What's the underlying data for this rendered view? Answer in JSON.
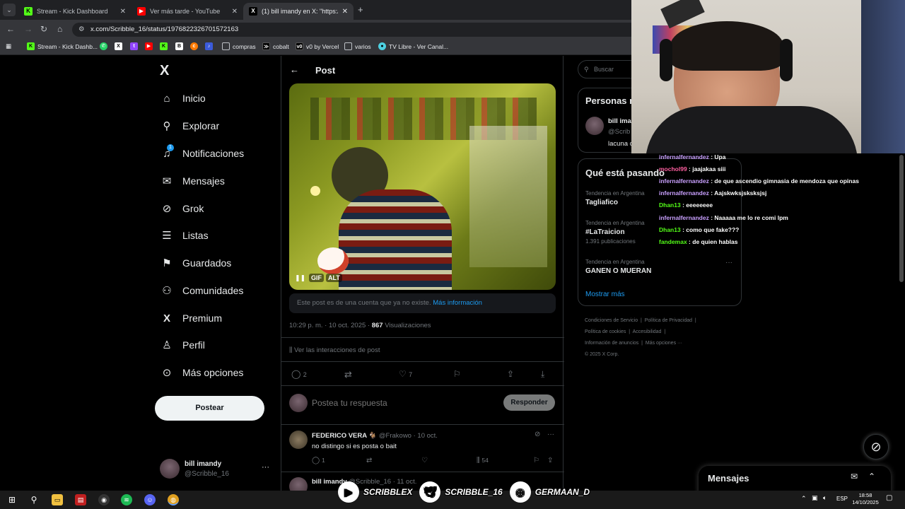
{
  "browser": {
    "tabs": [
      {
        "title": "Stream - Kick Dashboard",
        "icon": "kick-icon"
      },
      {
        "title": "Ver más tarde - YouTube",
        "icon": "youtube-icon"
      },
      {
        "title": "(1) bill imandy en X: \"https://t.c",
        "icon": "x-icon"
      }
    ],
    "url": "x.com/Scribble_16/status/1976822326701572163",
    "bookmarks": [
      "Stream - Kick Dashb...",
      "compras",
      "cobalt",
      "v0 by Vercel",
      "varios",
      "TV Libre - Ver Canal..."
    ]
  },
  "sidebar": {
    "logo": "X",
    "items": [
      {
        "label": "Inicio",
        "icon": "home-icon"
      },
      {
        "label": "Explorar",
        "icon": "search-icon"
      },
      {
        "label": "Notificaciones",
        "icon": "bell-icon",
        "badge": "1"
      },
      {
        "label": "Mensajes",
        "icon": "envelope-icon"
      },
      {
        "label": "Grok",
        "icon": "grok-icon"
      },
      {
        "label": "Listas",
        "icon": "list-icon"
      },
      {
        "label": "Guardados",
        "icon": "bookmark-icon"
      },
      {
        "label": "Comunidades",
        "icon": "people-icon"
      },
      {
        "label": "Premium",
        "icon": "x-icon"
      },
      {
        "label": "Perfil",
        "icon": "person-icon"
      },
      {
        "label": "Más opciones",
        "icon": "more-circle-icon"
      }
    ],
    "post_button": "Postear",
    "user": {
      "name": "bill imandy",
      "handle": "@Scribble_16"
    }
  },
  "post": {
    "header": "Post",
    "media_controls": {
      "gif": "GIF",
      "alt": "ALT"
    },
    "notice": "Este post es de una cuenta que ya no existe.",
    "notice_link": "Más información",
    "time": "10:29 p. m. · 10 oct. 2025 ·",
    "views": "867",
    "views_label": "Visualizaciones",
    "interactions": "Ver las interacciones de post",
    "actions": {
      "replies": "2",
      "likes": "7"
    },
    "reply_placeholder": "Postea tu respuesta",
    "reply_button": "Responder"
  },
  "replies": [
    {
      "name": "FEDERICO VERA 🐐",
      "handle": "@Frakowo",
      "date": "· 10 oct.",
      "text": "no distingo si es posta o bait",
      "replies": "1",
      "views": "54"
    },
    {
      "name": "bill imandy",
      "handle": "@Scribble_16",
      "date": "· 11 oct."
    }
  ],
  "right": {
    "search": "Buscar",
    "who_to_follow": "Personas r",
    "suggest": {
      "name": "bill ima",
      "handle": "@Scrib",
      "bio": "lacuna c"
    },
    "trending_title": "Qué está pasando",
    "trends": [
      {
        "context": "Tendencia en Argentina",
        "name": "Tagliafico"
      },
      {
        "context": "Tendencia en Argentina",
        "name": "#LaTraicion",
        "count": "1.391 publicaciones"
      },
      {
        "context": "Tendencia en Argentina",
        "name": "GANEN O MUERAN"
      }
    ],
    "show_more": "Mostrar más",
    "footer": [
      "Condiciones de Servicio",
      "Política de Privacidad",
      "Política de cookies",
      "Accesibilidad",
      "Información de anuncios",
      "Más opciones ···",
      "© 2025 X Corp."
    ],
    "messages": "Mensajes"
  },
  "chat": [
    {
      "user": "infernalfernandez",
      "msg": "Upa",
      "color": "#c9a0ff"
    },
    {
      "user": "mochol99",
      "msg": "jaajakaa siii",
      "color": "#ff5fa0"
    },
    {
      "user": "infernalfernandez",
      "msg": "de que ascendio gimnasia de mendoza que opinas",
      "color": "#c9a0ff"
    },
    {
      "user": "infernalfernandez",
      "msg": "Aajskwksjsksksjsj",
      "color": "#c9a0ff"
    },
    {
      "user": "Dhan13",
      "msg": "eeeeeeee",
      "color": "#53fc18"
    },
    {
      "user": "infernalfernandez",
      "msg": "Naaaaa me lo re comi lpm",
      "color": "#c9a0ff"
    },
    {
      "user": "Dhan13",
      "msg": "como que fake???",
      "color": "#53fc18"
    },
    {
      "user": "fandemax",
      "msg": "de quien hablas",
      "color": "#53fc18"
    }
  ],
  "overlay": {
    "socials": [
      "SCRIBBLEX",
      "SCRIBBLE_16",
      "GERMAAN_D"
    ]
  },
  "taskbar": {
    "lang": "ESP",
    "time": "18:58",
    "date": "14/10/2025"
  }
}
